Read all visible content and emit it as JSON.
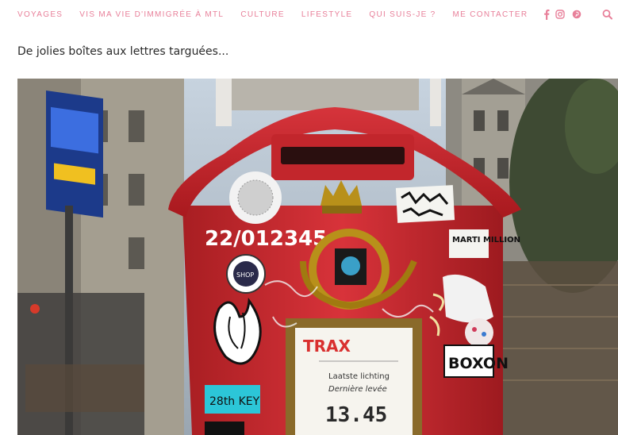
{
  "nav": {
    "items": [
      {
        "label": "VOYAGES"
      },
      {
        "label": "VIS MA VIE D'IMMIGRÉE À MTL"
      },
      {
        "label": "CULTURE"
      },
      {
        "label": "LIFESTYLE"
      },
      {
        "label": "QUI SUIS-JE ?"
      },
      {
        "label": "ME CONTACTER"
      }
    ],
    "social_icons": [
      "facebook-icon",
      "instagram-icon",
      "pinterest-icon"
    ],
    "search_icon": "search-icon",
    "accent_color": "#e8809a"
  },
  "post": {
    "caption": "De jolies boîtes aux lettres targuées..."
  },
  "photo": {
    "postbox_number": "22/012345",
    "sticker_marti": "MARTI MILLION",
    "sticker_boxon": "BOXON",
    "sticker_trax": "TRAX",
    "sticker_key": "28th KEY",
    "sticker_shop": "SHOP",
    "notice_line1": "Laatste lichting",
    "notice_line2": "Dernière levée",
    "notice_time": "13.45"
  }
}
